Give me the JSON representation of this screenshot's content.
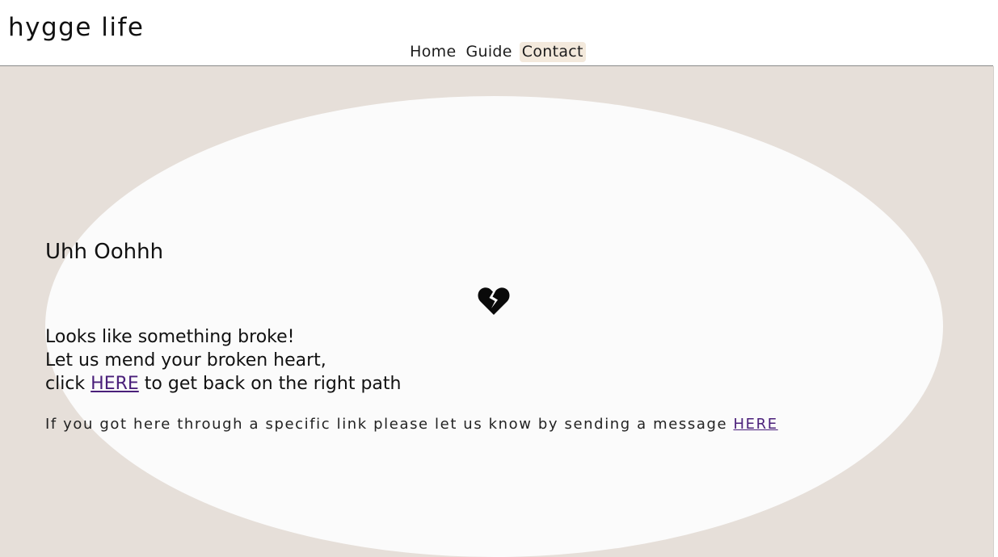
{
  "header": {
    "logo": "hygge life",
    "nav": [
      {
        "label": "Home",
        "active": false
      },
      {
        "label": "Guide",
        "active": false
      },
      {
        "label": "Contact",
        "active": true
      }
    ]
  },
  "error": {
    "title": "Uhh Oohhh",
    "icon": "broken-heart-icon",
    "line1": "Looks like something broke!",
    "line2": "Let us mend your broken heart,",
    "line3_before": "click ",
    "line3_link": "HERE",
    "line3_after": " to get back on the right path",
    "note_text": "If you got here through a specific link please let us know by sending a message ",
    "note_link": "HERE"
  },
  "colors": {
    "background": "#e6dfd9",
    "card": "#fbfbfb",
    "nav_active": "#f3e9dc",
    "link": "#4a1f7a"
  }
}
